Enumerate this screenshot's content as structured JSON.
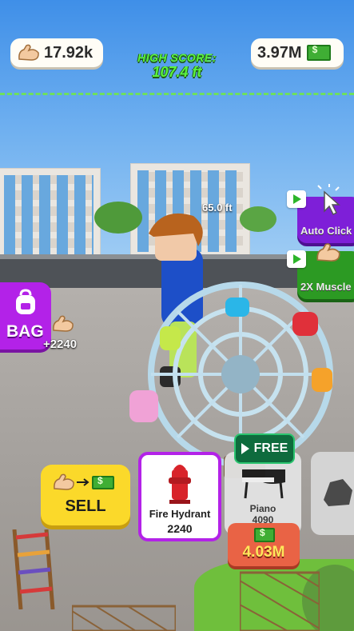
{
  "hud": {
    "muscle_value": "17.92k",
    "cash_value": "3.97M",
    "high_score_label": "HIGH SCORE:",
    "high_score_value": "107.4 ft",
    "current_height": "65.0 ft"
  },
  "side_buttons": {
    "auto_click_label": "Auto Click",
    "muscle_boost_label": "2X Muscle"
  },
  "bag": {
    "label": "BAG",
    "gain": "+2240"
  },
  "sell": {
    "label": "SELL"
  },
  "items": [
    {
      "name": "Fire Hydrant",
      "count": "2240",
      "state": "selected"
    },
    {
      "name": "Piano",
      "count": "4090",
      "state": "locked",
      "free_label": "FREE",
      "price": "4.03M"
    },
    {
      "name": "",
      "count": "",
      "state": "locked"
    }
  ],
  "colors": {
    "high_score": "#5bf23f",
    "bag": "#b322e8",
    "auto_click": "#7e1fd8",
    "muscle_boost": "#2c9a23",
    "sell": "#fbd92a",
    "price": "#e96345"
  },
  "icons": [
    "flexed-arm-icon",
    "cash-icon",
    "backpack-icon",
    "play-ad-icon",
    "cursor-click-icon",
    "fire-hydrant-icon",
    "piano-icon"
  ]
}
